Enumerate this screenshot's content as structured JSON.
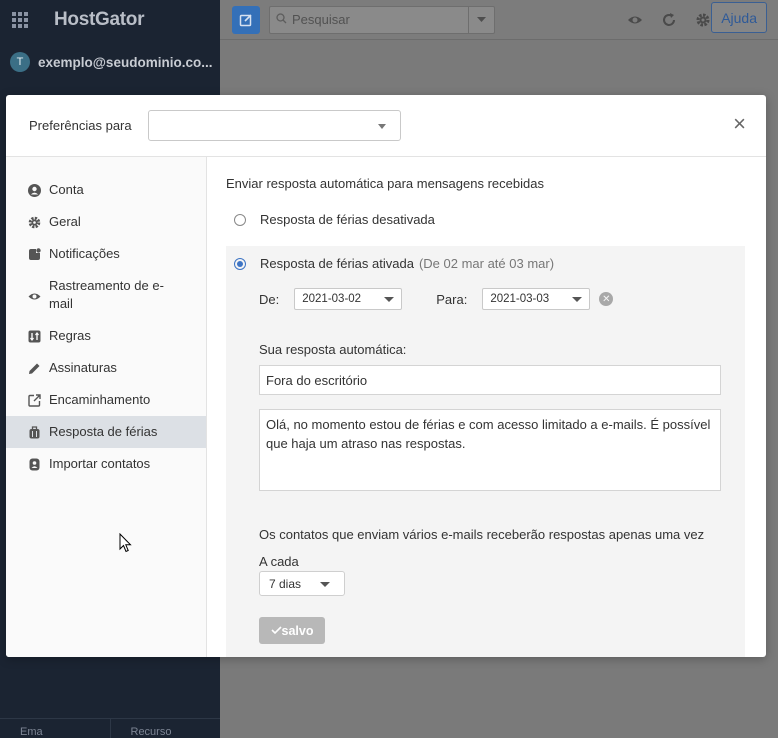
{
  "app": {
    "brand": "HostGator",
    "account_initial": "T",
    "account_email": "exemplo@seudominio.co...",
    "search_placeholder": "Pesquisar",
    "help_label": "Ajuda",
    "bottom_left": "Ema",
    "bottom_right": "Recurso"
  },
  "modal": {
    "preferences_label": "Preferências para",
    "preferences_value": "",
    "close_symbol": "×"
  },
  "nav": {
    "items": [
      {
        "label": "Conta",
        "icon": "user-circle-icon"
      },
      {
        "label": "Geral",
        "icon": "gear-icon"
      },
      {
        "label": "Notificações",
        "icon": "notification-icon"
      },
      {
        "label": "Rastreamento de e-mail",
        "icon": "eye-icon"
      },
      {
        "label": "Regras",
        "icon": "rules-icon"
      },
      {
        "label": "Assinaturas",
        "icon": "pencil-icon"
      },
      {
        "label": "Encaminhamento",
        "icon": "forward-icon"
      },
      {
        "label": "Resposta de férias",
        "icon": "suitcase-icon",
        "active": true
      },
      {
        "label": "Importar contatos",
        "icon": "contact-icon"
      }
    ]
  },
  "vacation": {
    "section_title": "Enviar resposta automática para mensagens recebidas",
    "option_off": "Resposta de férias desativada",
    "option_on": "Resposta de férias ativada",
    "option_on_range": "(De 02 mar até 03 mar)",
    "selected": "on",
    "from_label": "De:",
    "from_value": "2021-03-02",
    "to_label": "Para:",
    "to_value": "2021-03-03",
    "reply_label": "Sua resposta automática:",
    "subject_value": "Fora do escritório",
    "message_value": "Olá, no momento estou de férias e com acesso limitado a e-mails. É possível que haja um atraso nas respostas.",
    "note": "Os contatos que enviam vários e-mails receberão respostas apenas uma vez",
    "frequency_label": "A cada",
    "frequency_value": "7 dias",
    "save_label": "salvo"
  }
}
